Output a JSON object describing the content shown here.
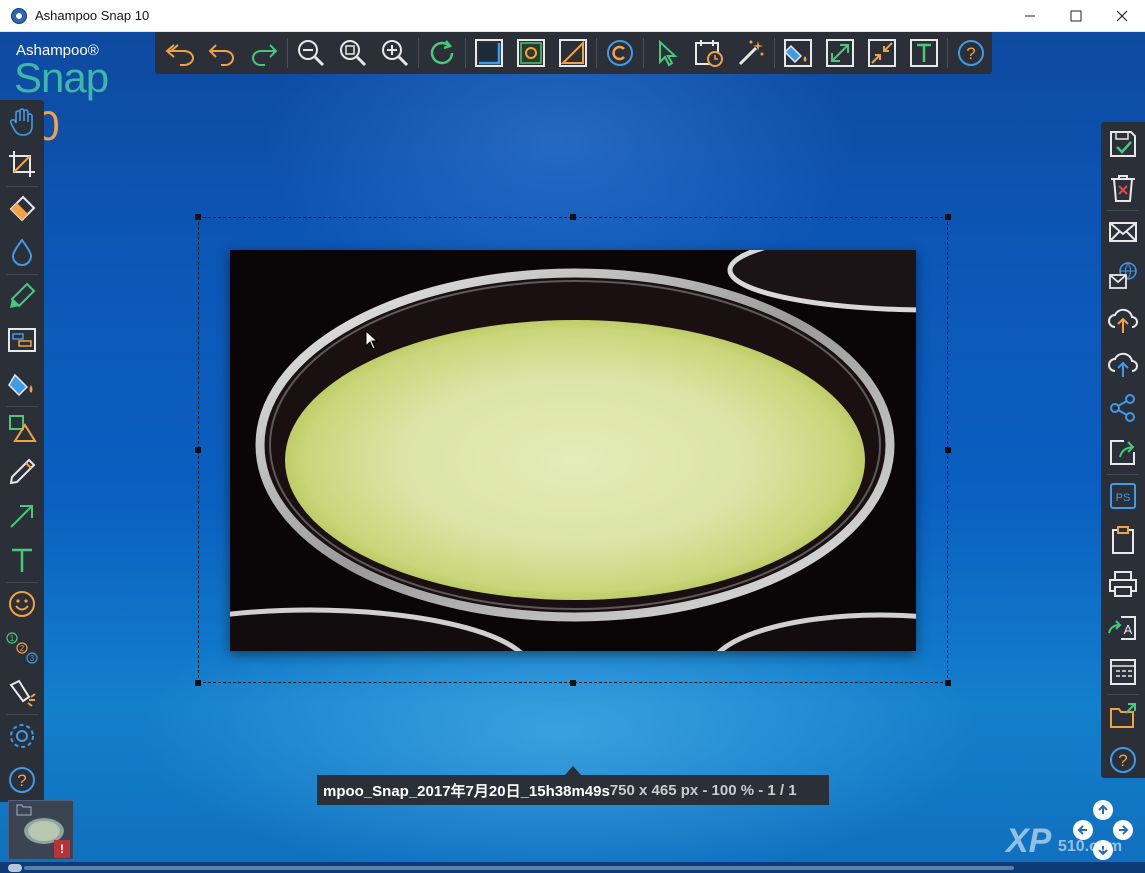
{
  "window": {
    "title": "Ashampoo Snap 10",
    "minimize_icon": "minimize-icon",
    "maximize_icon": "maximize-icon",
    "close_icon": "close-icon"
  },
  "logo": {
    "brand": "Ashampoo®",
    "product": "Snap",
    "version": "10",
    "brand_color": "#3fb7a8",
    "version_color": "#f2a144"
  },
  "top_toolbar": {
    "items": [
      "undo-all-icon",
      "undo-icon",
      "redo-icon",
      "zoom-out-icon",
      "zoom-fit-icon",
      "zoom-in-icon",
      "refresh-icon",
      "border-icon",
      "focus-icon",
      "resize-icon",
      "copyright-icon",
      "cursor-icon",
      "timestamp-icon",
      "magic-wand-icon",
      "fill-icon",
      "expand-icon",
      "shrink-icon",
      "text-frame-icon",
      "help-icon"
    ]
  },
  "left_toolbar": {
    "items": [
      "hand-icon",
      "crop-icon",
      "eraser-icon",
      "blur-icon",
      "highlighter-icon",
      "text-box-icon",
      "fill-icon",
      "shapes-icon",
      "pencil-icon",
      "arrow-icon",
      "text-icon",
      "emoji-icon",
      "numbering-icon",
      "spotlight-icon",
      "settings-icon",
      "help-icon"
    ]
  },
  "right_toolbar": {
    "items": [
      "save-icon",
      "delete-icon",
      "email-icon",
      "web-email-icon",
      "cloud-upload-icon",
      "cloud-upload-2-icon",
      "share-icon",
      "export-icon",
      "photoshop-icon",
      "clipboard-icon",
      "print-icon",
      "ocr-icon",
      "catalog-icon",
      "open-folder-icon",
      "help-icon"
    ]
  },
  "status": {
    "filename": "mpoo_Snap_2017年7月20日_15h38m49s",
    "info": "750 x 465 px - 100 % - 1 / 1"
  },
  "thumbnail": {
    "warning": "!"
  },
  "watermark": {
    "text": "XP",
    "sub": "510.com"
  },
  "colors": {
    "toolbar_bg": "#2a2f38",
    "icon_orange": "#f2a144",
    "icon_green": "#48c97a",
    "icon_blue": "#3e9be8",
    "soup_yellow": "#d8e29a"
  }
}
